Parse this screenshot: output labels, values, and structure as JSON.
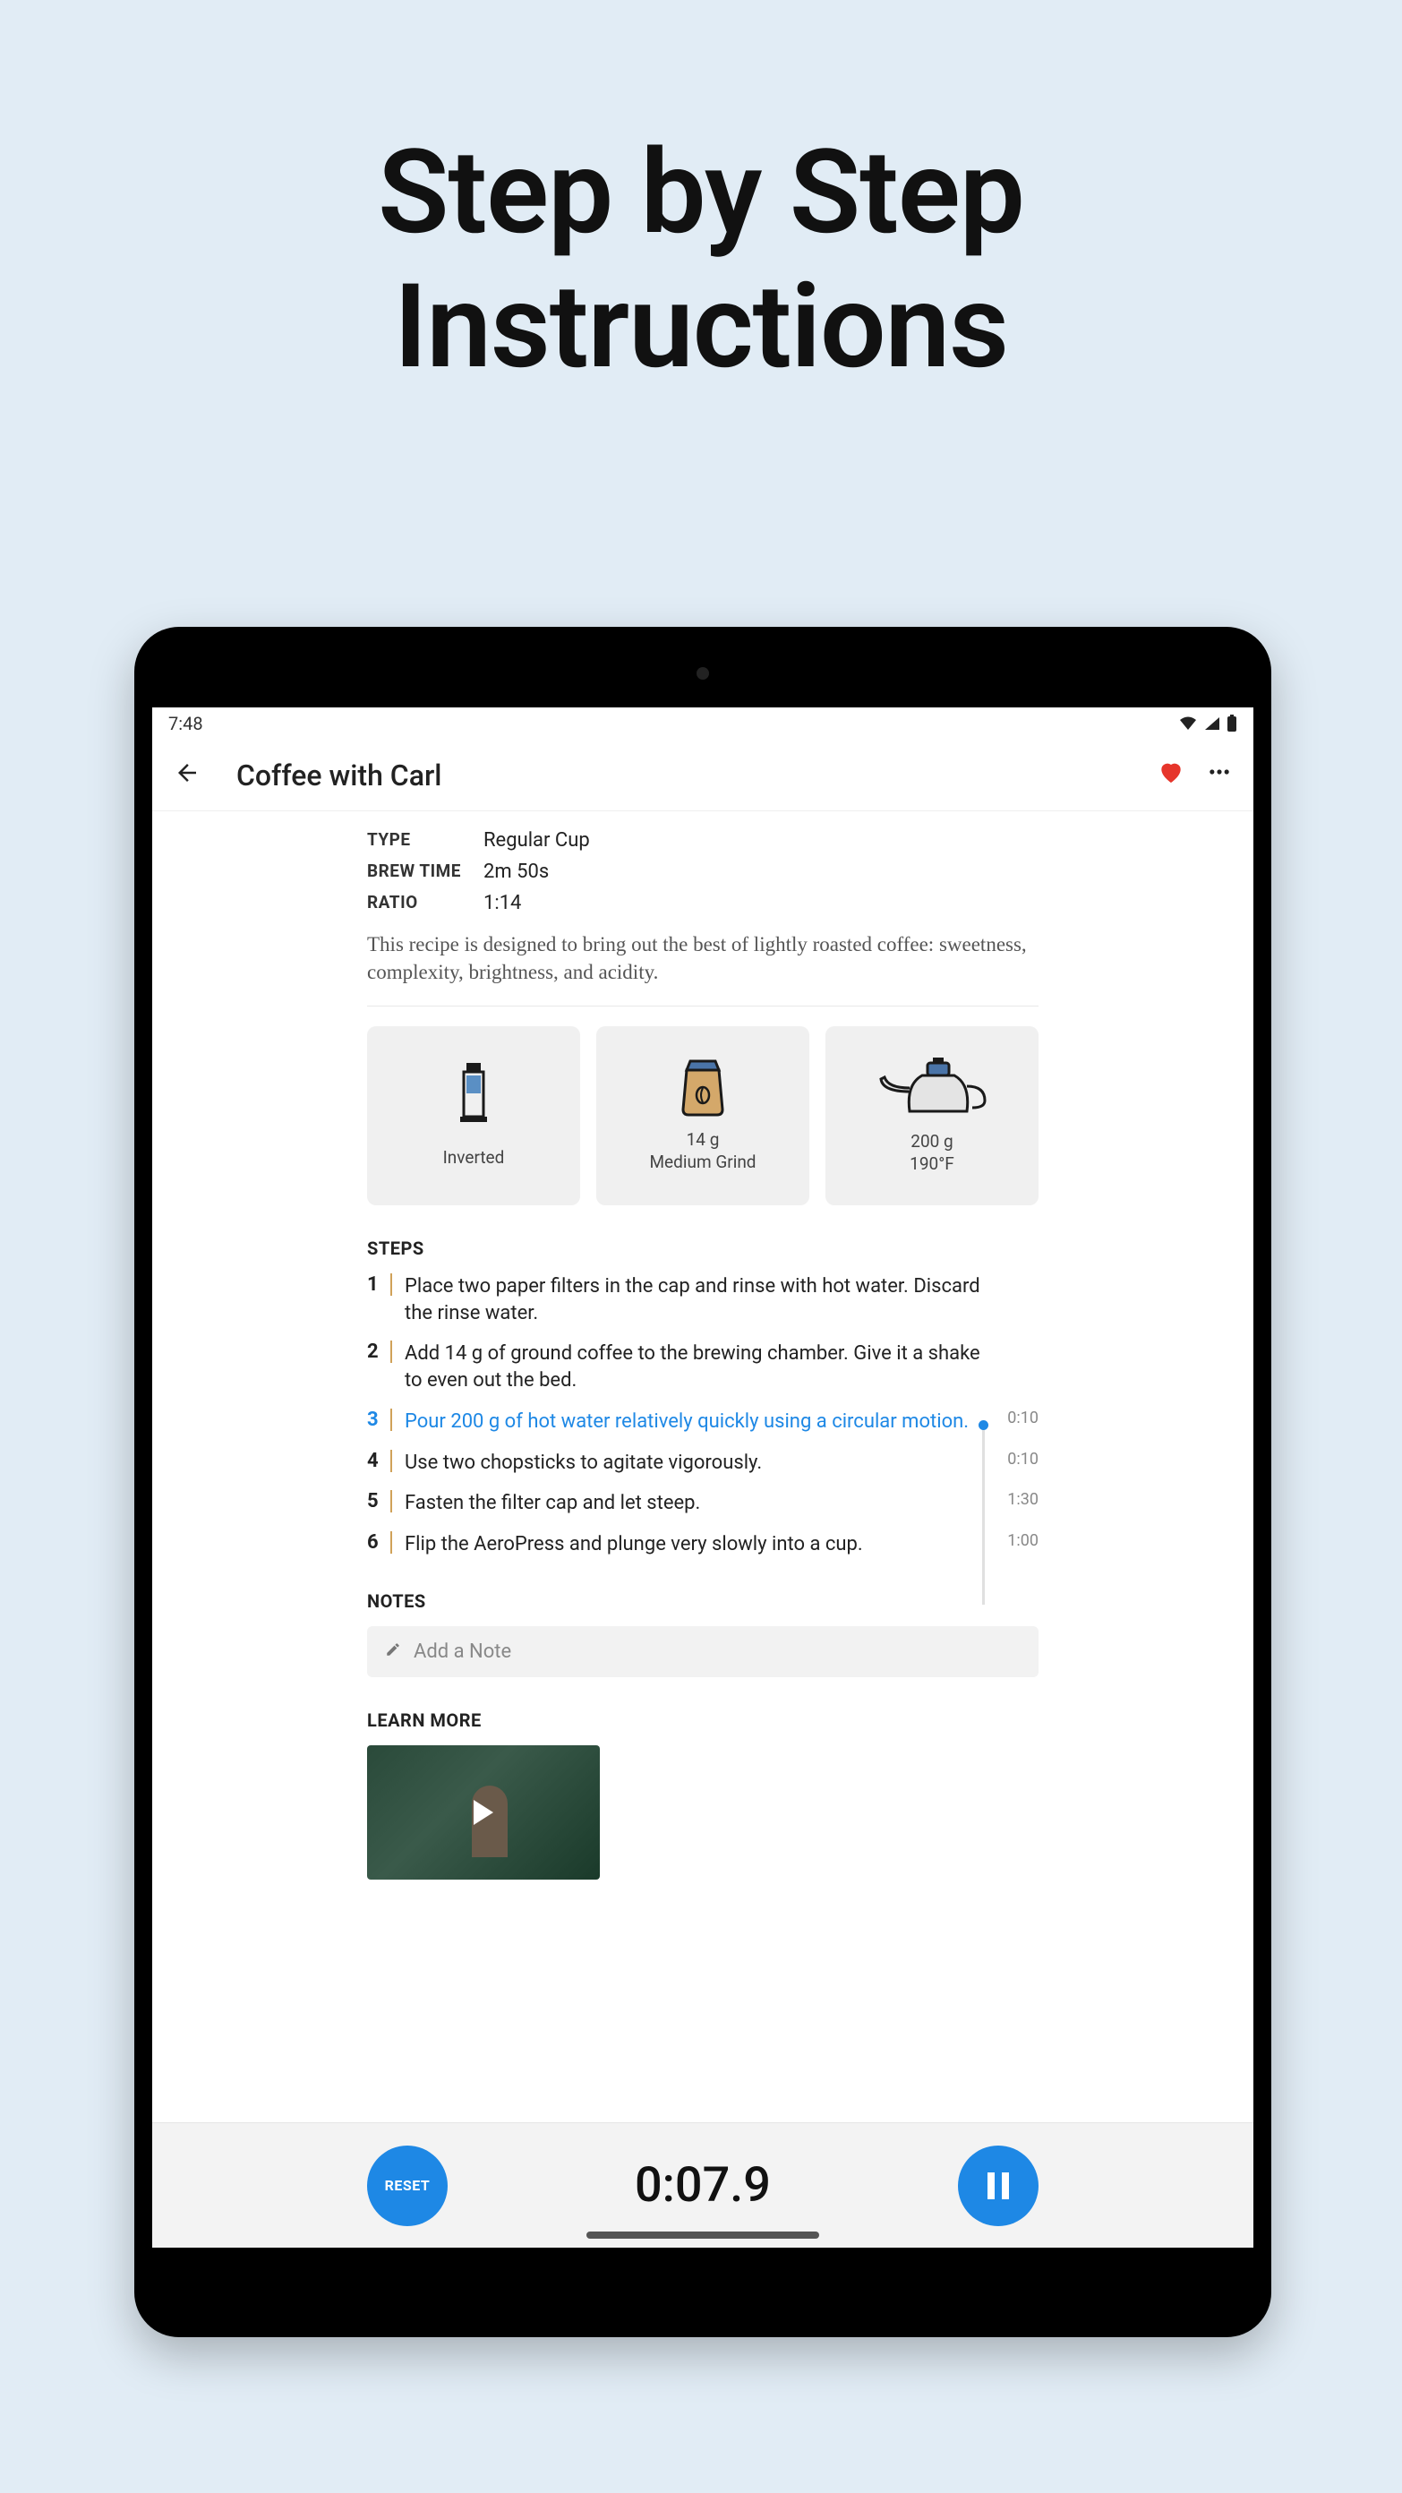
{
  "promo": {
    "line1": "Step by Step",
    "line2": "Instructions"
  },
  "statusBar": {
    "time": "7:48"
  },
  "appBar": {
    "title": "Coffee with Carl"
  },
  "meta": {
    "type_label": "TYPE",
    "type_value": "Regular Cup",
    "brew_label": "BREW TIME",
    "brew_value": "2m 50s",
    "ratio_label": "RATIO",
    "ratio_value": "1:14"
  },
  "description": "This recipe is designed to bring out the best of lightly roasted coffee: sweetness, complexity, brightness, and acidity.",
  "cards": [
    {
      "line1": "Inverted",
      "line2": ""
    },
    {
      "line1": "14 g",
      "line2": "Medium Grind"
    },
    {
      "line1": "200 g",
      "line2": "190°F"
    }
  ],
  "sections": {
    "steps": "STEPS",
    "notes": "NOTES",
    "learn": "LEARN MORE"
  },
  "steps": [
    {
      "n": "1",
      "text": "Place two paper filters in the cap and rinse with hot water. Discard the rinse water.",
      "time": ""
    },
    {
      "n": "2",
      "text": "Add 14 g of ground coffee to the brewing chamber. Give it a shake to even out the bed.",
      "time": ""
    },
    {
      "n": "3",
      "text": "Pour 200 g of hot water relatively quickly using a circular motion.",
      "time": "0:10"
    },
    {
      "n": "4",
      "text": "Use two chopsticks to agitate vigorously.",
      "time": "0:10"
    },
    {
      "n": "5",
      "text": "Fasten the filter cap and let steep.",
      "time": "1:30"
    },
    {
      "n": "6",
      "text": "Flip the AeroPress and plunge very slowly into a cup.",
      "time": "1:00"
    }
  ],
  "activeStep": 2,
  "notes": {
    "placeholder": "Add a Note"
  },
  "timer": {
    "reset": "RESET",
    "value": "0:07.9"
  }
}
